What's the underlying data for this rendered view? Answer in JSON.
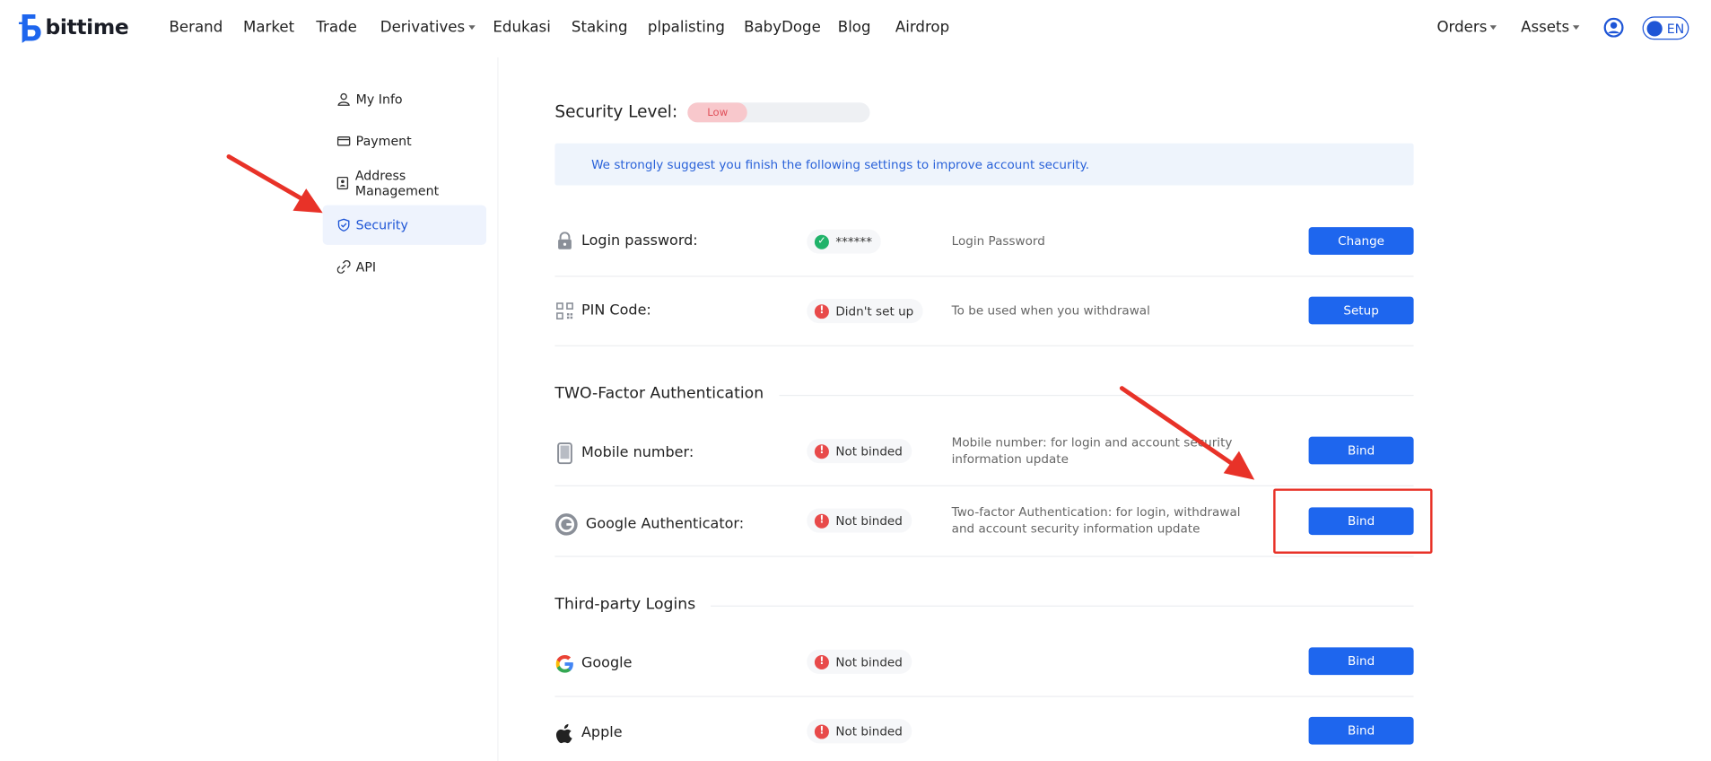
{
  "brand": {
    "name": "bittime"
  },
  "nav": {
    "items": [
      "Berand",
      "Market",
      "Trade",
      "Derivatives",
      "Edukasi",
      "Staking",
      "plpalisting",
      "BabyDoge",
      "Blog",
      "Airdrop"
    ],
    "orders": "Orders",
    "assets": "Assets",
    "lang": "EN"
  },
  "sidebar": {
    "items": [
      {
        "label": "My Info",
        "icon": "user-icon"
      },
      {
        "label": "Payment",
        "icon": "credit-card-icon"
      },
      {
        "label": "Address Management",
        "icon": "address-book-icon"
      },
      {
        "label": "Security",
        "icon": "shield-check-icon",
        "active": true
      },
      {
        "label": "API",
        "icon": "api-link-icon"
      }
    ]
  },
  "security": {
    "title": "Security Level:",
    "level": "Low",
    "level_fraction": 0.33,
    "notice": "We strongly suggest you finish the following settings to improve account security.",
    "rows": [
      {
        "label": "Login password:",
        "status": "******",
        "status_ok": true,
        "desc": "Login Password",
        "button": "Change"
      },
      {
        "label": "PIN Code:",
        "status": "Didn't set up",
        "status_ok": false,
        "desc": "To be used when you withdrawal",
        "button": "Setup"
      }
    ],
    "two_factor": {
      "title": "TWO-Factor Authentication",
      "rows": [
        {
          "label": "Mobile number:",
          "status": "Not binded",
          "desc_line1": "Mobile number: for login and account security",
          "desc_line2": "information update",
          "button": "Bind"
        },
        {
          "label": "Google Authenticator:",
          "status": "Not binded",
          "desc_line1": "Two-factor Authentication: for login, withdrawal",
          "desc_line2": "and account security information update",
          "button": "Bind"
        }
      ]
    },
    "third_party": {
      "title": "Third-party Logins",
      "rows": [
        {
          "label": "Google",
          "status": "Not binded",
          "button": "Bind"
        },
        {
          "label": "Apple",
          "status": "Not binded",
          "button": "Bind"
        }
      ]
    }
  },
  "colors": {
    "accent": "#1e66ee",
    "annotation": "#e83228",
    "ok": "#21b36a",
    "warn": "#e84a4a"
  }
}
